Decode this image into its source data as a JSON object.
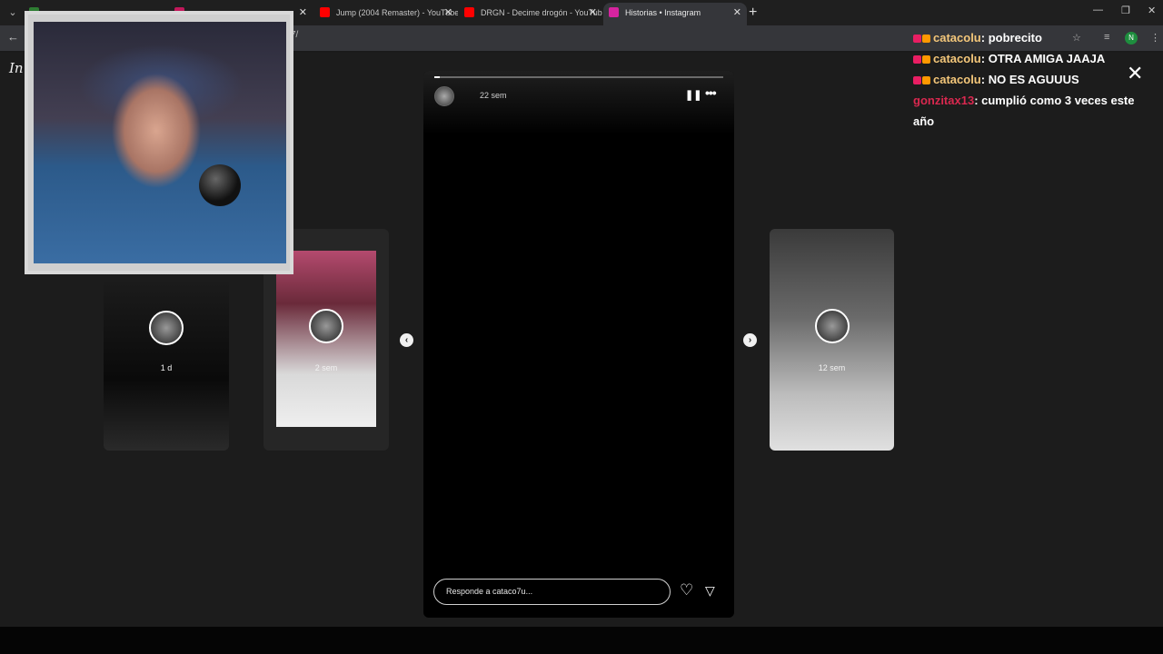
{
  "tabs": [
    {
      "label": "",
      "favicon_color": "#2e7d32"
    },
    {
      "label": "",
      "favicon_color": "#c2185b"
    },
    {
      "label": "Jump (2004 Remaster) - YouTube",
      "favicon_color": "#ff0000"
    },
    {
      "label": "DRGN - Decime drogón - YouTube",
      "favicon_color": "#ff0000"
    },
    {
      "label": "Historias • Instagram",
      "favicon_color": "#d6249f"
    }
  ],
  "toolbar": {
    "url_fragment": "7/",
    "profile_initial": "N"
  },
  "stories": {
    "left1": {
      "time": "1 d"
    },
    "left2": {
      "time": "2 sem"
    },
    "right1": {
      "time": "12 sem"
    },
    "main": {
      "time": "22 sem",
      "progress": 0.02,
      "reply_placeholder": "Responde a cataco7u..."
    }
  },
  "chat": [
    {
      "user": "catacolu",
      "text": "pobrecito",
      "color": "#f4c77a",
      "badges": true
    },
    {
      "user": "catacolu",
      "text": "OTRA AMIGA JAAJA",
      "color": "#f4c77a",
      "badges": true
    },
    {
      "user": "catacolu",
      "text": "NO ES AGUUUS",
      "color": "#f4c77a",
      "badges": true
    },
    {
      "user": "gonzitax13",
      "text": "cumplió como 3 veces este año",
      "color": "#d9284f",
      "badges": false
    }
  ]
}
